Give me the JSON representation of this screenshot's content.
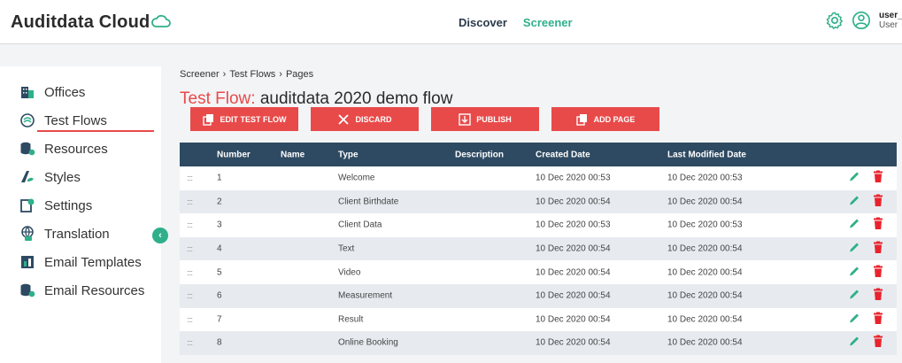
{
  "header": {
    "logo": "Auditdata Cloud",
    "nav": [
      "Discover",
      "Screener"
    ],
    "user_name": "user_",
    "user_role": "User"
  },
  "sidebar": {
    "items": [
      {
        "label": "Offices",
        "icon": "building-icon"
      },
      {
        "label": "Test Flows",
        "icon": "flow-icon"
      },
      {
        "label": "Resources",
        "icon": "database-icon"
      },
      {
        "label": "Styles",
        "icon": "paint-icon"
      },
      {
        "label": "Settings",
        "icon": "settings-icon"
      },
      {
        "label": "Translation",
        "icon": "globe-icon"
      },
      {
        "label": "Email Templates",
        "icon": "email-template-icon"
      },
      {
        "label": "Email Resources",
        "icon": "email-resource-icon"
      }
    ],
    "active": "Test Flows"
  },
  "breadcrumb": [
    "Screener",
    "Test Flows",
    "Pages"
  ],
  "title": {
    "label": "Test Flow:",
    "name": "auditdata 2020 demo flow"
  },
  "actions": [
    "EDIT TEST FLOW",
    "DISCARD",
    "PUBLISH",
    "ADD PAGE"
  ],
  "table": {
    "columns": [
      "Number",
      "Name",
      "Type",
      "Description",
      "Created Date",
      "Last Modified Date"
    ],
    "rows": [
      {
        "drag": "::::",
        "number": "1",
        "name": "",
        "type": "Welcome",
        "description": "",
        "created": "10 Dec 2020 00:53",
        "modified": "10 Dec 2020 00:53"
      },
      {
        "drag": "::::",
        "number": "2",
        "name": "",
        "type": "Client Birthdate",
        "description": "",
        "created": "10 Dec 2020 00:54",
        "modified": "10 Dec 2020 00:54"
      },
      {
        "drag": "::::",
        "number": "3",
        "name": "",
        "type": "Client Data",
        "description": "",
        "created": "10 Dec 2020 00:53",
        "modified": "10 Dec 2020 00:53"
      },
      {
        "drag": "::::",
        "number": "4",
        "name": "",
        "type": "Text",
        "description": "",
        "created": "10 Dec 2020 00:54",
        "modified": "10 Dec 2020 00:54"
      },
      {
        "drag": "::::",
        "number": "5",
        "name": "",
        "type": "Video",
        "description": "",
        "created": "10 Dec 2020 00:54",
        "modified": "10 Dec 2020 00:54"
      },
      {
        "drag": "::::",
        "number": "6",
        "name": "",
        "type": "Measurement",
        "description": "",
        "created": "10 Dec 2020 00:54",
        "modified": "10 Dec 2020 00:54"
      },
      {
        "drag": "::::",
        "number": "7",
        "name": "",
        "type": "Result",
        "description": "",
        "created": "10 Dec 2020 00:54",
        "modified": "10 Dec 2020 00:54"
      },
      {
        "drag": "::::",
        "number": "8",
        "name": "",
        "type": "Online Booking",
        "description": "",
        "created": "10 Dec 2020 00:54",
        "modified": "10 Dec 2020 00:54"
      }
    ]
  },
  "colors": {
    "accent_red": "#e84a4a",
    "accent_green": "#2fb08a",
    "table_header": "#2e4a62"
  }
}
